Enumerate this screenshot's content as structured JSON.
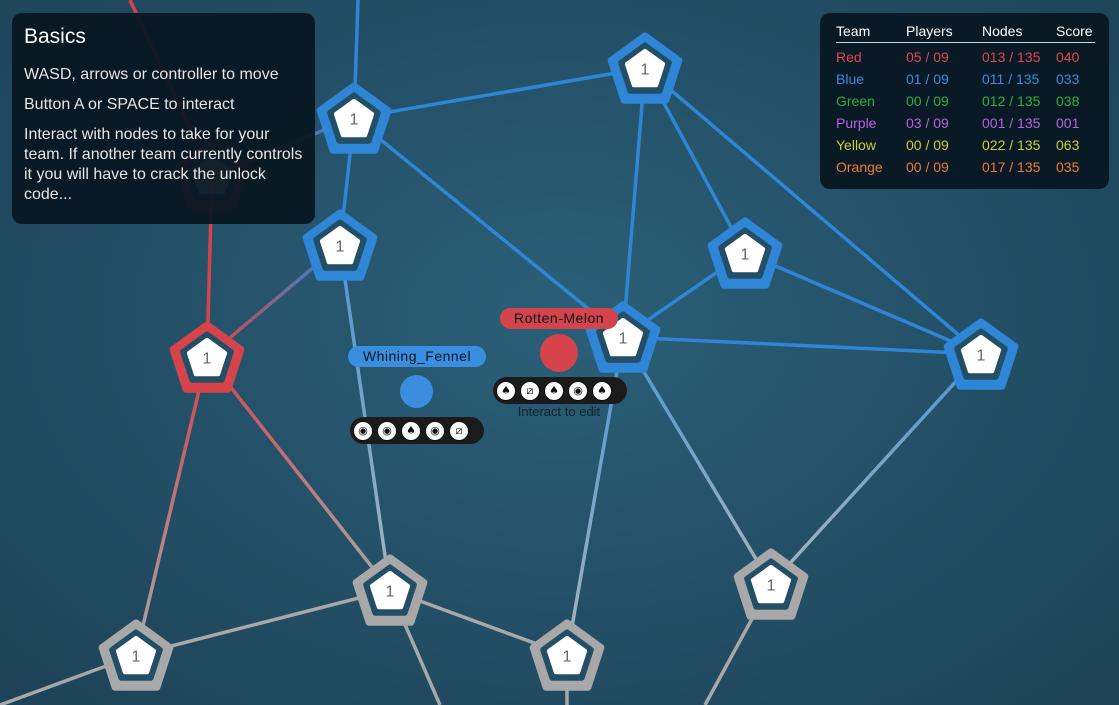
{
  "basics": {
    "title": "Basics",
    "line1": "WASD, arrows or controller to move",
    "line2": "Button A or SPACE to interact",
    "line3": "Interact with nodes to take for your team. If another team currently controls it you will have to crack the unlock code..."
  },
  "scoreboard": {
    "headers": [
      "Team",
      "Players",
      "Nodes",
      "Score"
    ],
    "rows": [
      {
        "team": "Red",
        "players": "05 / 09",
        "nodes": "013 / 135",
        "score": "040",
        "color": "#e0484f"
      },
      {
        "team": "Blue",
        "players": "01 / 09",
        "nodes": "011 / 135",
        "score": "033",
        "color": "#3a8ee0"
      },
      {
        "team": "Green",
        "players": "00 / 09",
        "nodes": "012 / 135",
        "score": "038",
        "color": "#2fb13c"
      },
      {
        "team": "Purple",
        "players": "03 / 09",
        "nodes": "001 / 135",
        "score": "001",
        "color": "#b863e0"
      },
      {
        "team": "Yellow",
        "players": "00 / 09",
        "nodes": "022 / 135",
        "score": "063",
        "color": "#c9cf3a"
      },
      {
        "team": "Orange",
        "players": "00 / 09",
        "nodes": "017 / 135",
        "score": "035",
        "color": "#ee7a3a"
      }
    ]
  },
  "players": {
    "blue": {
      "name": "Whining_Fennel",
      "color": "#3a8ee0",
      "code": [
        "target-icon",
        "target-icon",
        "tree-icon",
        "target-icon",
        "diamond-slash-icon"
      ]
    },
    "red": {
      "name": "Rotten-Melon",
      "color": "#e0484f",
      "code": [
        "tree-icon",
        "diamond-slash-icon",
        "tree-icon",
        "target-icon",
        "tree-icon"
      ],
      "hint": "Interact to edit"
    }
  },
  "node_value": "1",
  "colors": {
    "blue": "#2f86d6",
    "red": "#d5444b",
    "gray": "#a8a8a8",
    "background": "#234f66"
  }
}
